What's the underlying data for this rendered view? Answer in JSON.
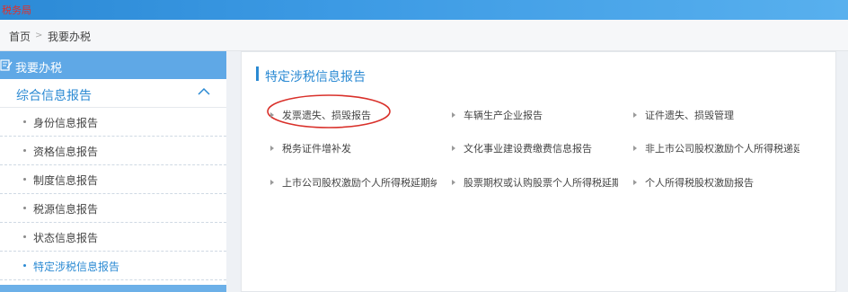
{
  "header": {
    "logo_text": "税务局"
  },
  "breadcrumb": {
    "home": "首页",
    "separator": ">",
    "current": "我要办税"
  },
  "sidebar": {
    "title": "我要办税",
    "group": "综合信息报告",
    "items": [
      {
        "label": "身份信息报告"
      },
      {
        "label": "资格信息报告"
      },
      {
        "label": "制度信息报告"
      },
      {
        "label": "税源信息报告"
      },
      {
        "label": "状态信息报告"
      },
      {
        "label": "特定涉税信息报告"
      }
    ]
  },
  "panel": {
    "title": "特定涉税信息报告",
    "links": [
      {
        "label": "发票遗失、损毁报告"
      },
      {
        "label": "车辆生产企业报告"
      },
      {
        "label": "证件遗失、损毁管理"
      },
      {
        "label": "税务证件增补发"
      },
      {
        "label": "文化事业建设费缴费信息报告"
      },
      {
        "label": "非上市公司股权激励个人所得税递延纳"
      },
      {
        "label": "上市公司股权激励个人所得税延期纳税"
      },
      {
        "label": "股票期权或认购股票个人所得税延期纳"
      },
      {
        "label": "个人所得税股权激励报告"
      }
    ]
  },
  "colors": {
    "accent": "#2b8ad3",
    "topbar": "#3c9ae4",
    "sidebar_head": "#5fa8e6",
    "highlight_oval": "#d9302a"
  },
  "icons": {
    "sidebar_head": "edit-document-icon",
    "group_toggle": "chevron-up-icon",
    "link_bullet": "triangle-right-icon"
  }
}
